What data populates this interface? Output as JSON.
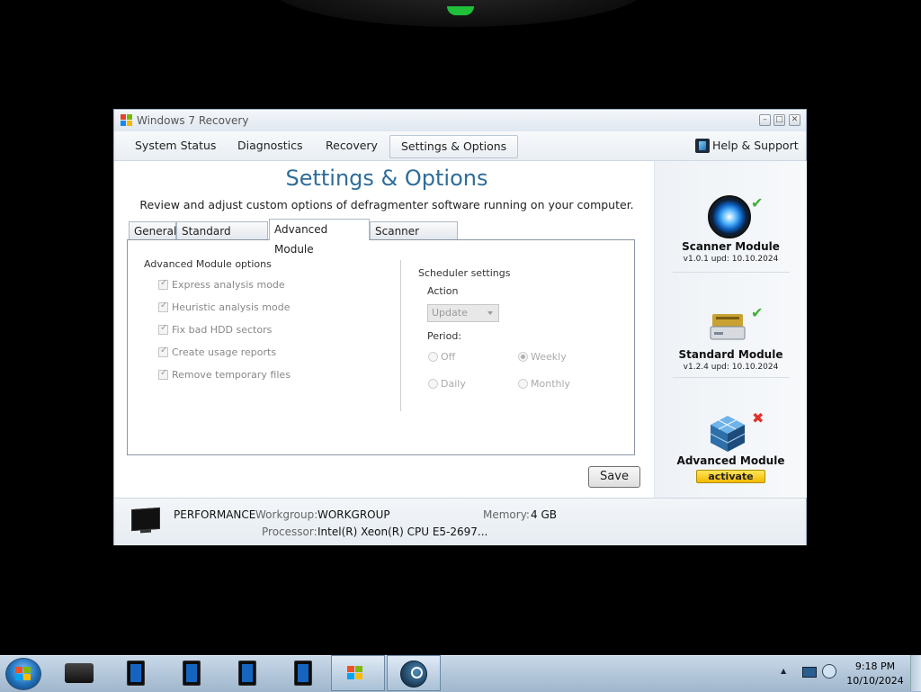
{
  "window": {
    "title": "Windows 7 Recovery"
  },
  "nav": {
    "items": [
      "System Status",
      "Diagnostics",
      "Recovery",
      "Settings & Options"
    ],
    "active": "Settings & Options",
    "help": "Help & Support"
  },
  "main": {
    "title": "Settings & Options",
    "subtitle": "Review and adjust custom options of defragmenter software running on your computer.",
    "tabs": [
      "General",
      "Standard Module",
      "Advanced Module",
      "Scanner Module"
    ],
    "active_tab": "Advanced Module",
    "options_title": "Advanced Module options",
    "options": [
      {
        "label": "Express analysis mode",
        "checked": true
      },
      {
        "label": "Heuristic analysis mode",
        "checked": true
      },
      {
        "label": "Fix bad HDD sectors",
        "checked": true
      },
      {
        "label": "Create usage reports",
        "checked": true
      },
      {
        "label": "Remove temporary files",
        "checked": true
      }
    ],
    "scheduler": {
      "title": "Scheduler settings",
      "action_label": "Action",
      "action_value": "Update",
      "period_label": "Period:",
      "periods": [
        {
          "label": "Off",
          "selected": false
        },
        {
          "label": "Weekly",
          "selected": true
        },
        {
          "label": "Daily",
          "selected": false
        },
        {
          "label": "Monthly",
          "selected": false
        }
      ]
    },
    "save_label": "Save"
  },
  "modules": [
    {
      "name": "Scanner Module",
      "version": "v1.0.1 upd: 10.10.2024",
      "status": "ok"
    },
    {
      "name": "Standard Module",
      "version": "v1.2.4 upd: 10.10.2024",
      "status": "ok"
    },
    {
      "name": "Advanced Module",
      "action": "activate",
      "status": "inactive"
    }
  ],
  "status_bar": {
    "label": "PERFORMANCE",
    "workgroup_label": "Workgroup:",
    "workgroup": "WORKGROUP",
    "memory_label": "Memory:",
    "memory": "4 GB",
    "processor_label": "Processor:",
    "processor": "Intel(R) Xeon(R) CPU E5-2697..."
  },
  "taskbar": {
    "time": "9:18 PM",
    "date": "10/10/2024"
  },
  "colors": {
    "title_blue": "#2e6d99",
    "activate_yellow": "#f3b900",
    "check_green": "#3fae35",
    "x_red": "#e0302a"
  }
}
